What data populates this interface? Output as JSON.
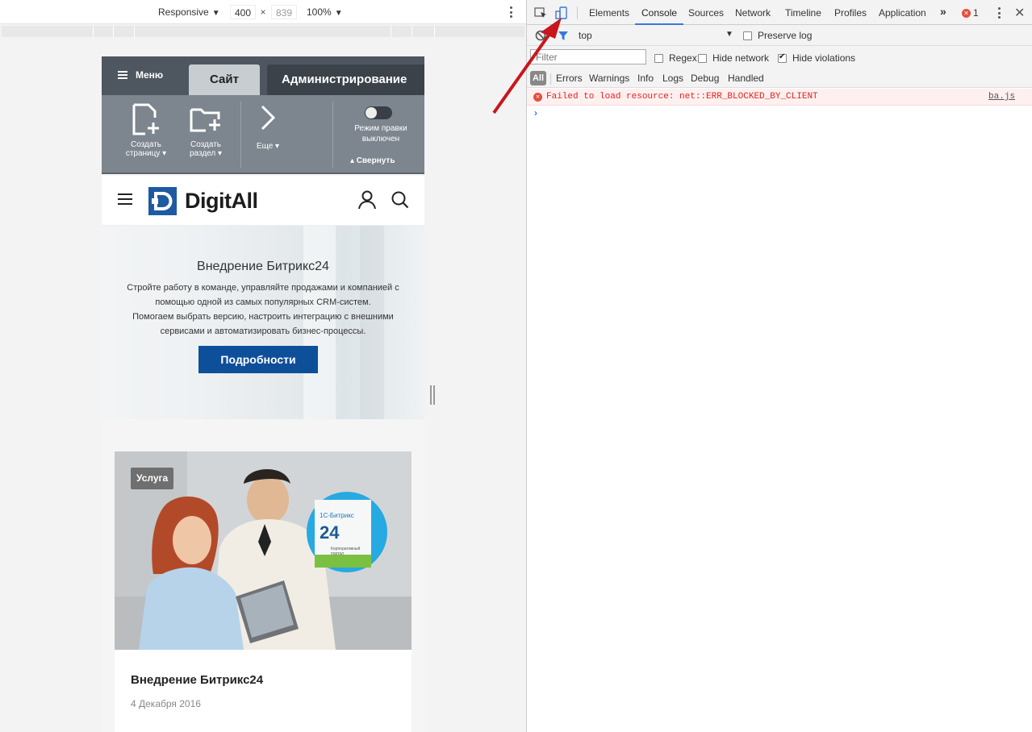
{
  "emulation": {
    "mode": "Responsive",
    "width": "400",
    "times": "×",
    "height": "839",
    "zoom": "100%"
  },
  "bitrix": {
    "menu_label": "Меню",
    "tab_site": "Сайт",
    "tab_admin": "Администрирование",
    "tools": [
      {
        "label": "Создать страницу",
        "l1": "Создать",
        "l2": "страницу ▾"
      },
      {
        "label": "Создать раздел",
        "l1": "Создать",
        "l2": "раздел ▾"
      },
      {
        "label": "Еще",
        "l1": "Еще ▾",
        "l2": ""
      }
    ],
    "edit_mode_l1": "Режим правки",
    "edit_mode_l2": "выключен",
    "collapse": "▴ Свернуть"
  },
  "site": {
    "logo_text": "DigitAll",
    "hero": {
      "title": "Внедрение Битрикс24",
      "text_line1": "Стройте работу в команде, управляйте продажами и компанией с помощью одной из самых популярных CRM-систем.",
      "text_line2": "Помогаем выбрать версию, настроить интеграцию с внешними сервисами и автоматизировать бизнес-процессы.",
      "button": "Подробности"
    },
    "card": {
      "badge": "Услуга",
      "title": "Внедрение Битрикс24",
      "date": "4 Декабря 2016",
      "product_brand": "1С-Битрикс",
      "product_num": "24",
      "product_sub1": "Корпоративный",
      "product_sub2": "портал"
    }
  },
  "devtools": {
    "tabs": [
      "Elements",
      "Console",
      "Sources",
      "Network",
      "Timeline",
      "Profiles",
      "Application"
    ],
    "active_tab": "Console",
    "more": "»",
    "error_count": "1",
    "context": "top",
    "preserve_log": "Preserve log",
    "filter_placeholder": "Filter",
    "regex": "Regex",
    "hide_network": "Hide network",
    "hide_violations": "Hide violations",
    "levels": [
      "All",
      "Errors",
      "Warnings",
      "Info",
      "Logs",
      "Debug",
      "Handled"
    ],
    "error_message": "Failed to load resource: net::ERR_BLOCKED_BY_CLIENT",
    "error_source": "ba.js",
    "prompt": "›"
  },
  "colors": {
    "accent_blue": "#3879d9",
    "brand_blue": "#0e4f9a",
    "error_red": "#e0241c",
    "arrow_red": "#c8161d"
  }
}
